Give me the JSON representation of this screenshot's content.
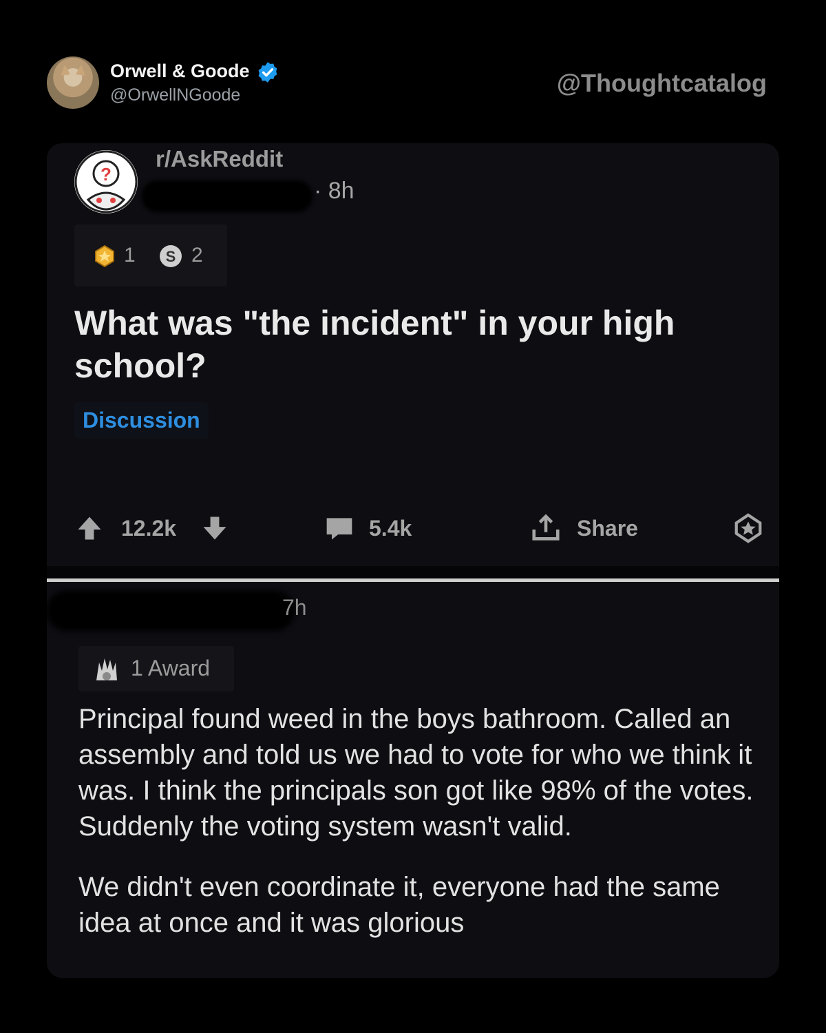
{
  "tweet": {
    "author_name": "Orwell & Goode",
    "author_handle": "@OrwellNGoode",
    "verified": true,
    "watermark": "@Thoughtcatalog"
  },
  "post": {
    "subreddit": "r/AskReddit",
    "time": "· 8h",
    "awards": [
      {
        "icon": "gold-award-icon",
        "count": "1"
      },
      {
        "icon": "silver-coin-icon",
        "count": "2"
      }
    ],
    "title": "What was \"the incident\" in your high school?",
    "flair": "Discussion",
    "upvotes": "12.2k",
    "comments": "5.4k",
    "share_label": "Share"
  },
  "comment": {
    "time": "7h",
    "award_label": "1 Award",
    "paragraphs": [
      "Principal found weed in the boys bathroom. Called an assembly and told us we had to vote for who we think it was. I think the principals son got like 98% of the votes. Suddenly the voting system wasn't valid.",
      "We didn't even coordinate it, everyone had the same idea at once and it was glorious"
    ]
  },
  "colors": {
    "background": "#000000",
    "card": "#0d0d12",
    "flair": "#2e8fe0",
    "verified": "#1d9bf0"
  }
}
